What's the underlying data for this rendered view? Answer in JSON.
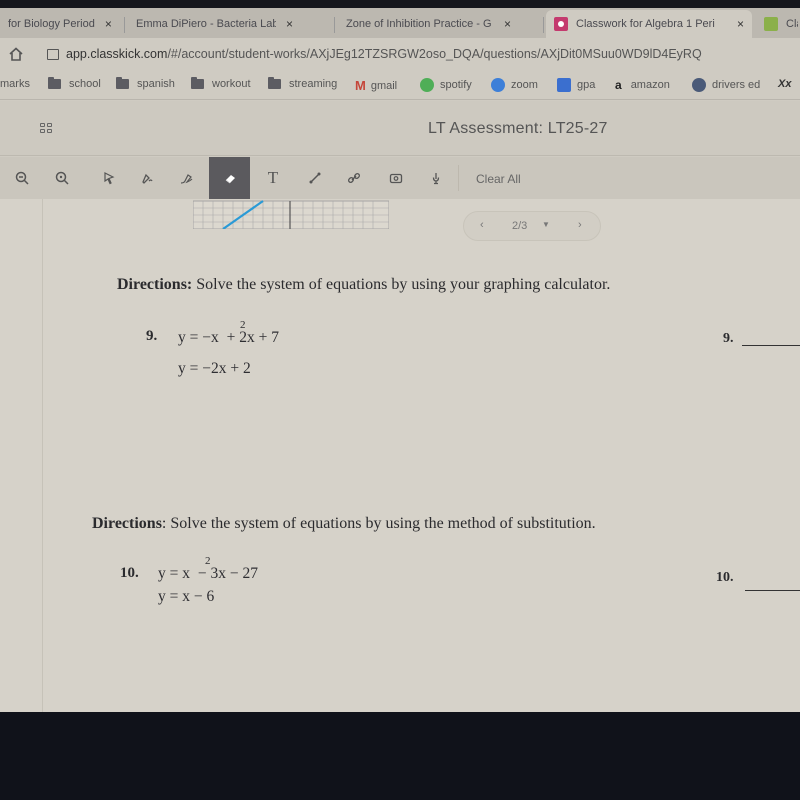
{
  "browser": {
    "tabs": [
      {
        "title": "for Biology Period",
        "icon": "doc-partial",
        "close": "×"
      },
      {
        "title": "Emma DiPiero - Bacteria Lab",
        "icon": "google-docs-icon",
        "close": "×"
      },
      {
        "title": "Zone of Inhibition Practice - G",
        "icon": "google-docs-icon",
        "close": "×"
      },
      {
        "title": "Classwork for Algebra 1 Peri",
        "icon": "google-classroom-icon",
        "close": "×",
        "active": true
      },
      {
        "title": "Cla",
        "icon": "classkick-icon"
      }
    ],
    "url_domain": "app.classkick.com",
    "url_path": "/#/account/student-works/AXjJEg12TZSRGW2oso_DQA/questions/AXjDit0MSuu0WD9lD4EyRQ",
    "bookmarks": [
      {
        "label": "marks",
        "icon": "none"
      },
      {
        "label": "school",
        "icon": "folder-icon"
      },
      {
        "label": "spanish",
        "icon": "folder-icon"
      },
      {
        "label": "workout",
        "icon": "folder-icon"
      },
      {
        "label": "streaming",
        "icon": "folder-icon"
      },
      {
        "label": "gmail",
        "icon": "gmail-icon"
      },
      {
        "label": "spotify",
        "icon": "spotify-icon"
      },
      {
        "label": "zoom",
        "icon": "zoom-icon"
      },
      {
        "label": "gpa",
        "icon": "gpa-icon"
      },
      {
        "label": "amazon",
        "icon": "amazon-icon"
      },
      {
        "label": "drivers ed",
        "icon": "globe-icon"
      },
      {
        "label": "Xx",
        "icon": "none"
      }
    ]
  },
  "app": {
    "title": "LT Assessment: LT25-27",
    "toolbar": {
      "tools": [
        "zoom-out",
        "zoom-in",
        "pointer",
        "pen",
        "highlighter",
        "eraser",
        "text",
        "line",
        "link",
        "camera",
        "microphone"
      ],
      "active_tool": "eraser",
      "text_tool_label": "T",
      "clear_all": "Clear All"
    },
    "pager": {
      "prev": "‹",
      "current": "2/3",
      "caret": "▼",
      "next": "›"
    }
  },
  "document": {
    "section1": {
      "directions_label": "Directions:",
      "directions_text": " Solve the system of equations by using your graphing calculator.",
      "question_number": "9.",
      "eq1_lhs": "y = −x",
      "eq1_exp": "2",
      "eq1_rhs": " + 2x + 7",
      "eq2": "y = −2x + 2",
      "answer_label": "9."
    },
    "section2": {
      "directions_label": "Directions",
      "directions_text": ": Solve the system of equations by using the method of substitution.",
      "question_number": "10.",
      "eq1_lhs": "y = x",
      "eq1_exp": "2",
      "eq1_rhs": " − 3x − 27",
      "eq2": "y = x − 6",
      "answer_label": "10."
    }
  }
}
